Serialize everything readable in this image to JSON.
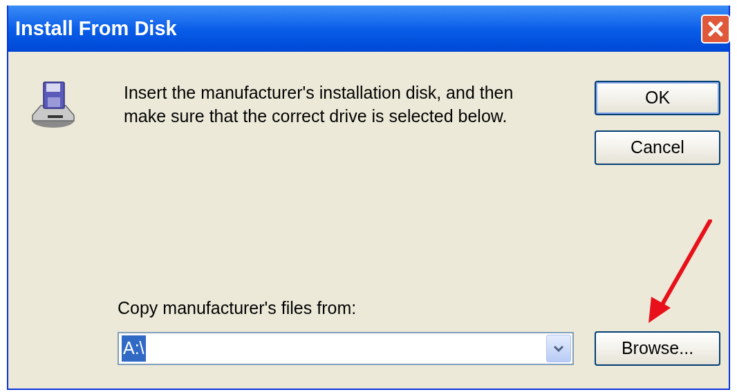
{
  "window": {
    "title": "Install From Disk"
  },
  "message": "Insert the manufacturer's installation disk, and then make sure that the correct drive is selected below.",
  "buttons": [
    {
      "label": "OK",
      "default": true
    },
    {
      "label": "Cancel",
      "default": false
    }
  ],
  "copy_from": {
    "label": "Copy manufacturer's files from:",
    "value": "A:\\",
    "text_selected": true
  },
  "browse_button": {
    "label": "Browse..."
  }
}
